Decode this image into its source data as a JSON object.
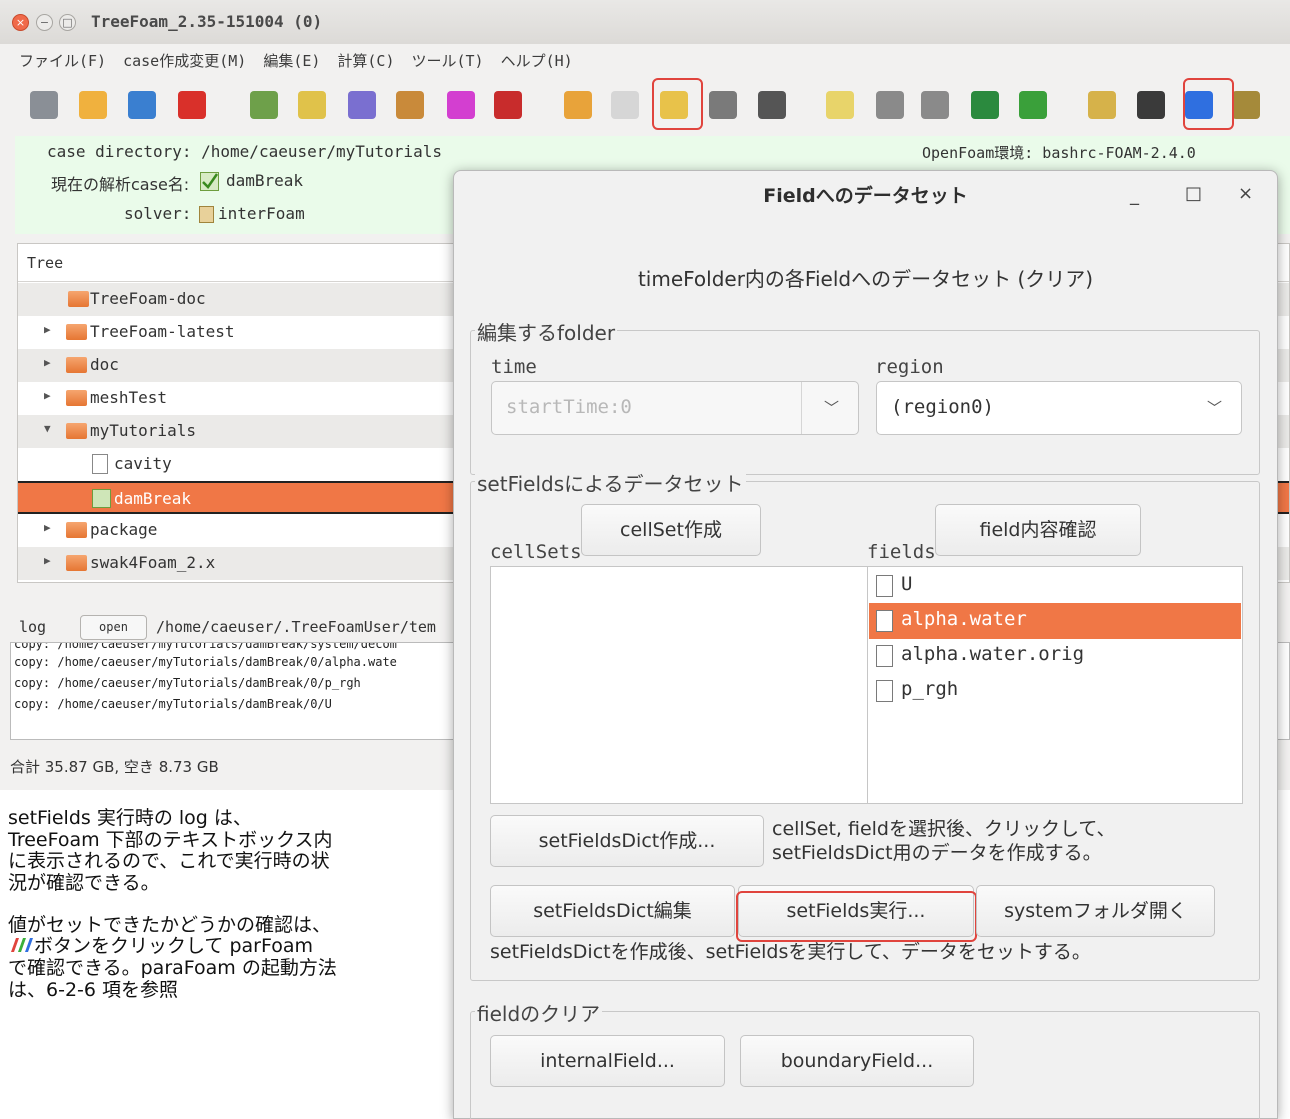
{
  "window": {
    "title": "TreeFoam_2.35-151004 (0)",
    "close_glyph": "×",
    "min_glyph": "−",
    "max_glyph": "□"
  },
  "menu": [
    "ファイル(F)",
    "case作成変更(M)",
    "編集(E)",
    "計算(C)",
    "ツール(T)",
    "ヘルプ(H)"
  ],
  "toolbar": {
    "icons": [
      {
        "name": "tools-icon",
        "color": "#8a8f96"
      },
      {
        "name": "up-arrow-icon",
        "color": "#f0b13e"
      },
      {
        "name": "refresh-icon",
        "color": "#3a7fd0"
      },
      {
        "name": "stop-icon",
        "color": "#d9302a"
      },
      {
        "name": "check-case-icon",
        "color": "#6ea04a"
      },
      {
        "name": "edit-case-icon",
        "color": "#e0c24a"
      },
      {
        "name": "mesh-icon",
        "color": "#7a6fd0"
      },
      {
        "name": "topo-icon",
        "color": "#c98a3a"
      },
      {
        "name": "mreg-icon",
        "color": "#d33fd0"
      },
      {
        "name": "helyx-icon",
        "color": "#c82c2c"
      },
      {
        "name": "grid-icon",
        "color": "#e8a33a"
      },
      {
        "name": "document-icon",
        "color": "#d6d6d6"
      },
      {
        "name": "data-set-icon",
        "color": "#e8c24a"
      },
      {
        "name": "cons-icon",
        "color": "#7a7a7a"
      },
      {
        "name": "sys-icon",
        "color": "#555555"
      },
      {
        "name": "star-folder-icon",
        "color": "#e8d46a"
      },
      {
        "name": "database-icon",
        "color": "#8a8a8a"
      },
      {
        "name": "run-icon",
        "color": "#8a8a8a"
      },
      {
        "name": "monitor-icon",
        "color": "#2b8a3e"
      },
      {
        "name": "layout-icon",
        "color": "#3aa03a"
      },
      {
        "name": "ruler-icon",
        "color": "#d6b24a"
      },
      {
        "name": "terminal-icon",
        "color": "#3a3a3a"
      },
      {
        "name": "parafoam-icon",
        "color": "#2f6fe0"
      },
      {
        "name": "plane-icon",
        "color": "#a58a3a"
      }
    ]
  },
  "info": {
    "case_directory_label": "case directory:",
    "case_directory": "/home/caeuser/myTutorials",
    "openfoam_env": "OpenFoam環境: bashrc-FOAM-2.4.0",
    "case_name_label": "現在の解析case名:",
    "case_name": "damBreak",
    "solver_label": "solver:",
    "solver": "interFoam"
  },
  "tree": {
    "header": "Tree",
    "rows": [
      {
        "label": "TreeFoam-doc",
        "arrow": "",
        "type": "folder"
      },
      {
        "label": "TreeFoam-latest",
        "arrow": "▶",
        "type": "folder"
      },
      {
        "label": "doc",
        "arrow": "▶",
        "type": "folder"
      },
      {
        "label": "meshTest",
        "arrow": "▶",
        "type": "folder"
      },
      {
        "label": "myTutorials",
        "arrow": "▼",
        "type": "folder"
      },
      {
        "label": "cavity",
        "arrow": "",
        "type": "file"
      },
      {
        "label": "damBreak",
        "arrow": "",
        "type": "check"
      },
      {
        "label": "package",
        "arrow": "▶",
        "type": "folder"
      },
      {
        "label": "swak4Foam_2.x",
        "arrow": "▶",
        "type": "folder"
      }
    ]
  },
  "log": {
    "label": "log",
    "open_button": "open",
    "path": "/home/caeuser/.TreeFoamUser/tem",
    "lines": [
      "copy: /home/caeuser/myTutorials/damBreak/system/decom",
      "copy: /home/caeuser/myTutorials/damBreak/0/alpha.wate",
      "copy: /home/caeuser/myTutorials/damBreak/0/p_rgh",
      "copy: /home/caeuser/myTutorials/damBreak/0/U"
    ]
  },
  "disk_status": "合計 35.87 GB,  空き 8.73 GB",
  "annotation": {
    "para1": "setFields 実行時の log は、TreeFoam 下部のテキストボックス内に表示されるので、これで実行時の状況が確認できる。",
    "para2a": "値がセットできたかどうかの確認は、",
    "para2b": "ボタンをクリックして parFoam で確認できる。paraFoam の起動方法は、6-2-6 項を参照"
  },
  "dialog": {
    "title": "Fieldへのデータセット",
    "min_glyph": "_",
    "max_glyph": "□",
    "close_glyph": "×",
    "heading": "timeFolder内の各Fieldへのデータセット (クリア)",
    "folder_group": {
      "title": "編集するfolder",
      "time_label": "time",
      "time_value": "startTime:0",
      "region_label": "region",
      "region_value": "(region0)"
    },
    "setfields_group": {
      "title": "setFieldsによるデータセット",
      "cellset_button": "cellSet作成",
      "field_check_button": "field内容確認",
      "cellsets_label": "cellSets",
      "fields_label": "fields",
      "fields": [
        "U",
        "alpha.water",
        "alpha.water.orig",
        "p_rgh"
      ],
      "selected_field": "alpha.water",
      "dict_create_button": "setFieldsDict作成...",
      "dict_create_note_1": "cellSet, fieldを選択後、クリックして、",
      "dict_create_note_2": "setFieldsDict用のデータを作成する。",
      "dict_edit_button": "setFieldsDict編集",
      "run_button": "setFields実行...",
      "system_folder_button": "systemフォルダ開く",
      "run_note": "setFieldsDictを作成後、setFieldsを実行して、データをセットする。"
    },
    "clear_group": {
      "title": "fieldのクリア",
      "internal_button": "internalField...",
      "boundary_button": "boundaryField..."
    }
  },
  "colors": {
    "selection": "#f07746",
    "highlight_outline": "#e0443d",
    "info_background": "#eafbea"
  }
}
